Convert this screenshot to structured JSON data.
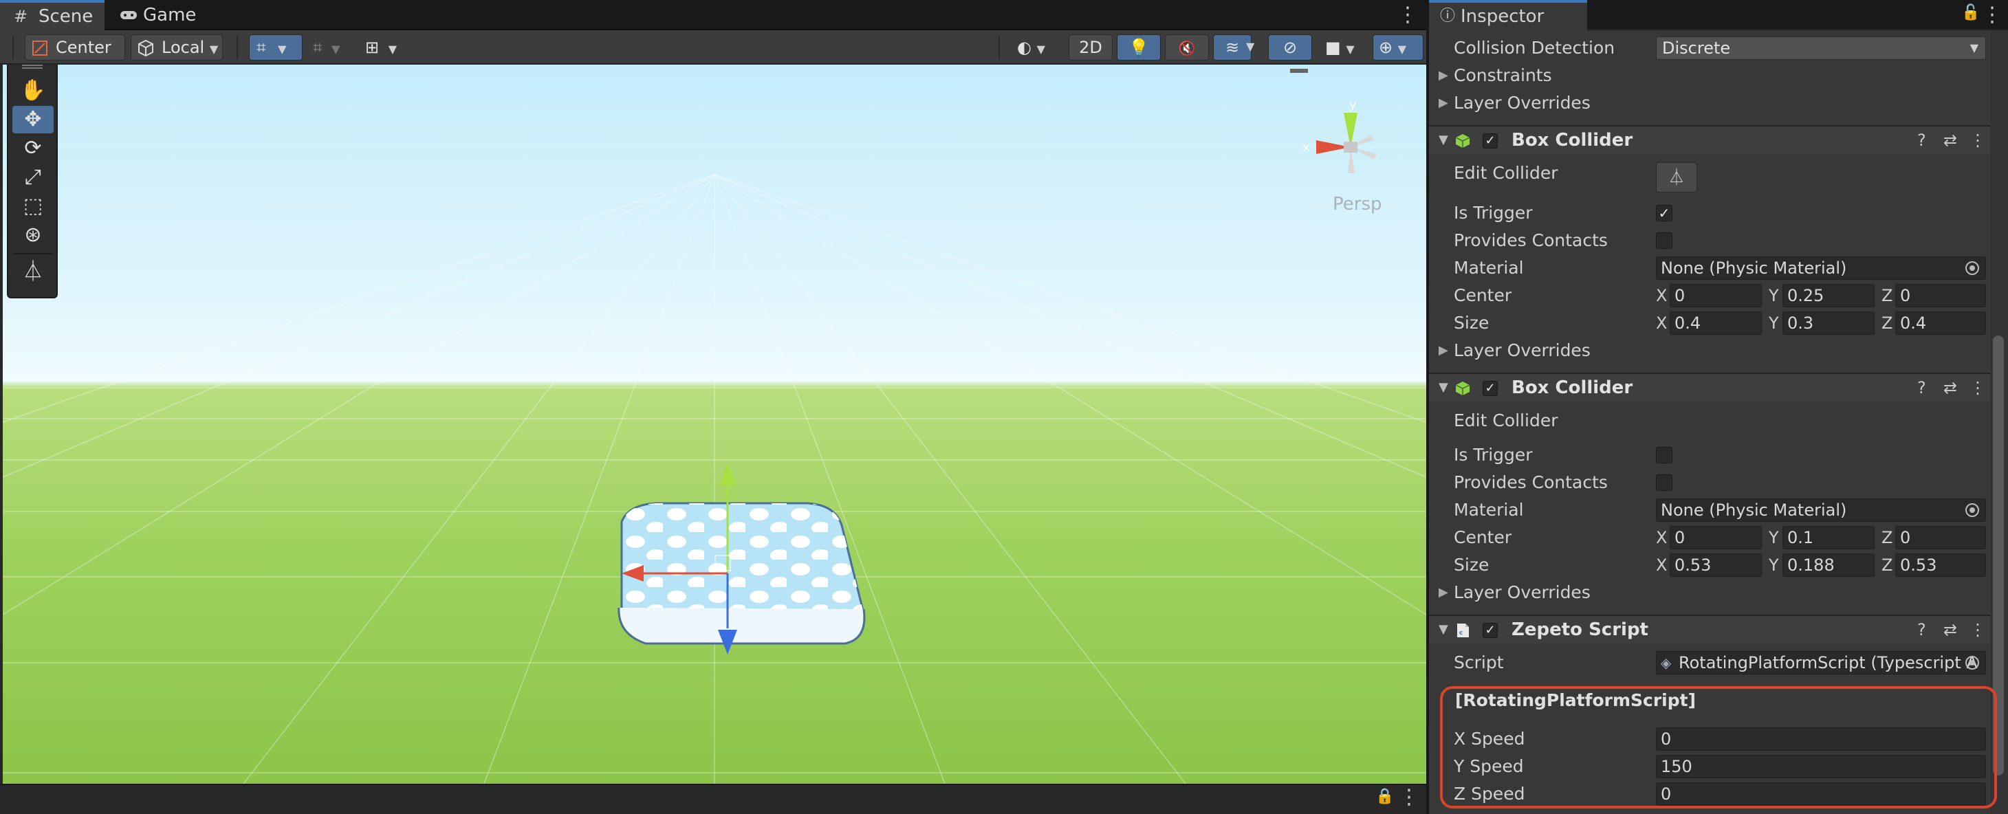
{
  "scene_panel": {
    "tabs": [
      {
        "label": "Scene",
        "icon": "grid-icon"
      },
      {
        "label": "Game",
        "icon": "gamepad-icon"
      }
    ],
    "toolbar": {
      "pivot_label": "Center",
      "space_label": "Local",
      "mode_2d": "2D"
    },
    "gizmo": {
      "x_label": "x",
      "y_label": "y",
      "persp_label": "Persp"
    },
    "tools": [
      "hand-tool-icon",
      "move-tool-icon",
      "rotate-tool-icon",
      "scale-tool-icon",
      "rect-tool-icon",
      "transform-tool-icon",
      "custom-tool-icon"
    ]
  },
  "inspector": {
    "tab_label": "Inspector",
    "rigidbody": {
      "collision_detection_label": "Collision Detection",
      "collision_detection_value": "Discrete",
      "constraints_label": "Constraints",
      "layer_overrides_label": "Layer Overrides"
    },
    "box_collider_1": {
      "title": "Box Collider",
      "edit_collider_label": "Edit Collider",
      "is_trigger_label": "Is Trigger",
      "is_trigger": true,
      "provides_contacts_label": "Provides Contacts",
      "provides_contacts": false,
      "material_label": "Material",
      "material_value": "None (Physic Material)",
      "center_label": "Center",
      "center": {
        "x": "0",
        "y": "0.25",
        "z": "0"
      },
      "size_label": "Size",
      "size": {
        "x": "0.4",
        "y": "0.3",
        "z": "0.4"
      },
      "layer_overrides_label": "Layer Overrides"
    },
    "box_collider_2": {
      "title": "Box Collider",
      "edit_collider_label": "Edit Collider",
      "is_trigger_label": "Is Trigger",
      "is_trigger": false,
      "provides_contacts_label": "Provides Contacts",
      "provides_contacts": false,
      "material_label": "Material",
      "material_value": "None (Physic Material)",
      "center_label": "Center",
      "center": {
        "x": "0",
        "y": "0.1",
        "z": "0"
      },
      "size_label": "Size",
      "size": {
        "x": "0.53",
        "y": "0.188",
        "z": "0.53"
      },
      "layer_overrides_label": "Layer Overrides"
    },
    "zepeto_script": {
      "title": "Zepeto Script",
      "script_label": "Script",
      "script_value": "RotatingPlatformScript (Typescript A",
      "section_title": "[RotatingPlatformScript]",
      "x_speed_label": "X Speed",
      "x_speed": "0",
      "y_speed_label": "Y Speed",
      "y_speed": "150",
      "z_speed_label": "Z Speed",
      "z_speed": "0"
    },
    "axis": {
      "x": "X",
      "y": "Y",
      "z": "Z"
    }
  },
  "colors": {
    "accent": "#3a79bb",
    "highlight": "#d9442c",
    "grass": "#9ed25e",
    "sky": "#c4ecfa"
  }
}
